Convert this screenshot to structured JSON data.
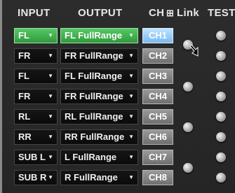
{
  "headers": {
    "input": "INPUT",
    "output": "OUTPUT",
    "ch": "CH",
    "link_icon": "link-grid-icon",
    "link": "Link",
    "test": "TEST"
  },
  "rows": [
    {
      "input": "FL",
      "output": "FL FullRange",
      "ch": "CH1"
    },
    {
      "input": "FR",
      "output": "FR FullRange",
      "ch": "CH2"
    },
    {
      "input": "FL",
      "output": "FL FullRange",
      "ch": "CH3"
    },
    {
      "input": "FR",
      "output": "FR FullRange",
      "ch": "CH4"
    },
    {
      "input": "RL",
      "output": "RL FullRange",
      "ch": "CH5"
    },
    {
      "input": "RR",
      "output": "RR FullRange",
      "ch": "CH6"
    },
    {
      "input": "SUB L",
      "output": "L FullRange",
      "ch": "CH7"
    },
    {
      "input": "SUB R",
      "output": "R FullRange",
      "ch": "CH8"
    }
  ],
  "colors": {
    "active_select": "#3fae4c",
    "active_channel": "#9ccffa",
    "inactive_channel": "#888888",
    "background": "#282828"
  },
  "dropdown_arrow": "▼"
}
